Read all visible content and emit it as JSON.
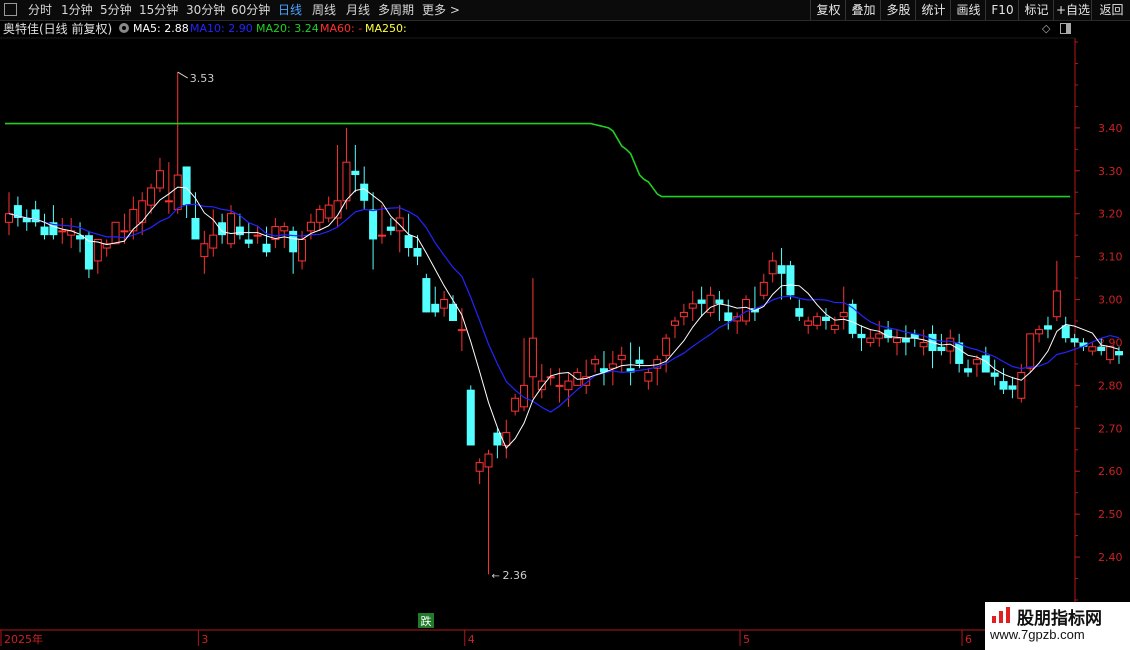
{
  "toolbar": {
    "periods": [
      "分时",
      "1分钟",
      "5分钟",
      "15分钟",
      "30分钟",
      "60分钟",
      "日线",
      "周线",
      "月线",
      "多周期",
      "更多 >"
    ],
    "active_period": "日线",
    "right_buttons": [
      "复权",
      "叠加",
      "多股",
      "统计",
      "画线",
      "F10",
      "标记",
      "+自选",
      "返回"
    ]
  },
  "info": {
    "title": "奥特佳(日线 前复权)",
    "ma5": "MA5: 2.88",
    "ma10": "MA10: 2.90",
    "ma20": "MA20: 3.24",
    "ma60": "MA60: -",
    "ma250": "MA250:"
  },
  "colors": {
    "up": "#ff3232",
    "down": "#54ffff",
    "ma5": "#ffffff",
    "ma10": "#2424ff",
    "ma20": "#20d020",
    "ma60": "#ff3030",
    "ma250": "#ffff3c",
    "axis": "#b01818",
    "label": "#cc2222"
  },
  "annotations": {
    "high": "3.53",
    "low": "2.36",
    "signal": "跌"
  },
  "watermark": {
    "name": "股朋指标网",
    "url": "www.7gpzb.com"
  },
  "chart_data": {
    "type": "candlestick",
    "ylim": [
      2.3,
      3.6
    ],
    "y_ticks": [
      3.4,
      3.3,
      3.2,
      3.1,
      3.0,
      2.9,
      2.8,
      2.7,
      2.6,
      2.5,
      2.4
    ],
    "x_labels": [
      "2025年",
      "3",
      "4",
      "5",
      "6"
    ],
    "x_label_bars": [
      0,
      22,
      52,
      83,
      108
    ],
    "ohlc": [
      [
        3.18,
        3.25,
        3.15,
        3.2
      ],
      [
        3.22,
        3.24,
        3.17,
        3.19
      ],
      [
        3.19,
        3.21,
        3.16,
        3.18
      ],
      [
        3.21,
        3.23,
        3.17,
        3.18
      ],
      [
        3.17,
        3.2,
        3.14,
        3.15
      ],
      [
        3.18,
        3.22,
        3.14,
        3.15
      ],
      [
        3.16,
        3.19,
        3.13,
        3.16
      ],
      [
        3.15,
        3.19,
        3.12,
        3.16
      ],
      [
        3.15,
        3.18,
        3.11,
        3.14
      ],
      [
        3.15,
        3.16,
        3.05,
        3.07
      ],
      [
        3.09,
        3.14,
        3.06,
        3.14
      ],
      [
        3.12,
        3.14,
        3.1,
        3.13
      ],
      [
        3.13,
        3.18,
        3.13,
        3.18
      ],
      [
        3.16,
        3.2,
        3.13,
        3.16
      ],
      [
        3.16,
        3.24,
        3.14,
        3.21
      ],
      [
        3.18,
        3.25,
        3.15,
        3.23
      ],
      [
        3.22,
        3.27,
        3.2,
        3.26
      ],
      [
        3.26,
        3.33,
        3.25,
        3.3
      ],
      [
        3.23,
        3.32,
        3.2,
        3.23
      ],
      [
        3.21,
        3.53,
        3.2,
        3.29
      ],
      [
        3.31,
        3.31,
        3.19,
        3.22
      ],
      [
        3.19,
        3.25,
        3.16,
        3.14
      ],
      [
        3.1,
        3.16,
        3.06,
        3.13
      ],
      [
        3.12,
        3.21,
        3.1,
        3.15
      ],
      [
        3.18,
        3.2,
        3.13,
        3.15
      ],
      [
        3.13,
        3.22,
        3.12,
        3.2
      ],
      [
        3.17,
        3.2,
        3.14,
        3.15
      ],
      [
        3.14,
        3.18,
        3.12,
        3.13
      ],
      [
        3.15,
        3.17,
        3.13,
        3.15
      ],
      [
        3.13,
        3.17,
        3.1,
        3.11
      ],
      [
        3.14,
        3.19,
        3.12,
        3.17
      ],
      [
        3.16,
        3.18,
        3.12,
        3.17
      ],
      [
        3.16,
        3.17,
        3.06,
        3.11
      ],
      [
        3.09,
        3.16,
        3.07,
        3.14
      ],
      [
        3.16,
        3.2,
        3.14,
        3.18
      ],
      [
        3.18,
        3.22,
        3.16,
        3.21
      ],
      [
        3.19,
        3.24,
        3.18,
        3.22
      ],
      [
        3.19,
        3.36,
        3.17,
        3.23
      ],
      [
        3.23,
        3.4,
        3.21,
        3.32
      ],
      [
        3.3,
        3.36,
        3.25,
        3.29
      ],
      [
        3.27,
        3.31,
        3.21,
        3.23
      ],
      [
        3.21,
        3.25,
        3.07,
        3.14
      ],
      [
        3.15,
        3.22,
        3.13,
        3.15
      ],
      [
        3.17,
        3.19,
        3.15,
        3.16
      ],
      [
        3.16,
        3.22,
        3.11,
        3.19
      ],
      [
        3.15,
        3.2,
        3.1,
        3.12
      ],
      [
        3.12,
        3.15,
        3.08,
        3.1
      ],
      [
        3.05,
        3.06,
        2.97,
        2.97
      ],
      [
        2.99,
        3.03,
        2.96,
        2.97
      ],
      [
        2.98,
        3.02,
        2.96,
        3.0
      ],
      [
        2.99,
        3.01,
        2.95,
        2.95
      ],
      [
        2.93,
        2.98,
        2.88,
        2.93
      ],
      [
        2.79,
        2.8,
        2.66,
        2.66
      ],
      [
        2.6,
        2.63,
        2.57,
        2.62
      ],
      [
        2.61,
        2.65,
        2.36,
        2.64
      ],
      [
        2.69,
        2.7,
        2.63,
        2.66
      ],
      [
        2.66,
        2.72,
        2.63,
        2.69
      ],
      [
        2.74,
        2.78,
        2.73,
        2.77
      ],
      [
        2.75,
        2.91,
        2.74,
        2.8
      ],
      [
        2.82,
        3.05,
        2.77,
        2.91
      ],
      [
        2.79,
        2.85,
        2.77,
        2.81
      ],
      [
        2.82,
        2.84,
        2.8,
        2.82
      ],
      [
        2.8,
        2.84,
        2.76,
        2.8
      ],
      [
        2.79,
        2.83,
        2.75,
        2.81
      ],
      [
        2.8,
        2.84,
        2.8,
        2.83
      ],
      [
        2.8,
        2.86,
        2.78,
        2.82
      ],
      [
        2.85,
        2.87,
        2.83,
        2.86
      ],
      [
        2.84,
        2.88,
        2.8,
        2.83
      ],
      [
        2.84,
        2.88,
        2.8,
        2.85
      ],
      [
        2.86,
        2.89,
        2.83,
        2.87
      ],
      [
        2.84,
        2.9,
        2.8,
        2.83
      ],
      [
        2.86,
        2.89,
        2.84,
        2.85
      ],
      [
        2.81,
        2.84,
        2.79,
        2.83
      ],
      [
        2.84,
        2.87,
        2.8,
        2.86
      ],
      [
        2.87,
        2.92,
        2.83,
        2.91
      ],
      [
        2.94,
        2.96,
        2.91,
        2.95
      ],
      [
        2.96,
        2.99,
        2.94,
        2.97
      ],
      [
        2.98,
        3.02,
        2.95,
        2.99
      ],
      [
        3.0,
        3.03,
        2.96,
        2.99
      ],
      [
        2.97,
        3.03,
        2.96,
        3.01
      ],
      [
        3.0,
        3.02,
        2.95,
        2.99
      ],
      [
        2.97,
        3.0,
        2.93,
        2.95
      ],
      [
        2.95,
        2.97,
        2.92,
        2.96
      ],
      [
        2.95,
        3.01,
        2.94,
        3.0
      ],
      [
        2.98,
        3.03,
        2.95,
        2.97
      ],
      [
        3.01,
        3.06,
        3.0,
        3.04
      ],
      [
        3.06,
        3.11,
        3.04,
        3.09
      ],
      [
        3.08,
        3.12,
        3.0,
        3.06
      ],
      [
        3.08,
        3.09,
        3.0,
        3.01
      ],
      [
        2.98,
        3.0,
        2.95,
        2.96
      ],
      [
        2.94,
        2.96,
        2.92,
        2.95
      ],
      [
        2.94,
        2.97,
        2.93,
        2.96
      ],
      [
        2.96,
        2.98,
        2.93,
        2.95
      ],
      [
        2.93,
        2.96,
        2.92,
        2.94
      ],
      [
        2.96,
        3.03,
        2.93,
        2.97
      ],
      [
        2.99,
        3.0,
        2.91,
        2.92
      ],
      [
        2.92,
        2.94,
        2.88,
        2.91
      ],
      [
        2.9,
        2.93,
        2.89,
        2.91
      ],
      [
        2.91,
        2.95,
        2.89,
        2.92
      ],
      [
        2.93,
        2.95,
        2.9,
        2.91
      ],
      [
        2.9,
        2.93,
        2.87,
        2.91
      ],
      [
        2.91,
        2.94,
        2.87,
        2.9
      ],
      [
        2.92,
        2.93,
        2.89,
        2.91
      ],
      [
        2.89,
        2.93,
        2.87,
        2.9
      ],
      [
        2.92,
        2.94,
        2.84,
        2.88
      ],
      [
        2.89,
        2.92,
        2.87,
        2.88
      ],
      [
        2.88,
        2.93,
        2.85,
        2.91
      ],
      [
        2.9,
        2.92,
        2.83,
        2.85
      ],
      [
        2.84,
        2.86,
        2.82,
        2.83
      ],
      [
        2.85,
        2.87,
        2.82,
        2.86
      ],
      [
        2.87,
        2.89,
        2.83,
        2.83
      ],
      [
        2.83,
        2.86,
        2.8,
        2.82
      ],
      [
        2.81,
        2.84,
        2.78,
        2.79
      ],
      [
        2.8,
        2.82,
        2.77,
        2.79
      ],
      [
        2.77,
        2.85,
        2.76,
        2.83
      ],
      [
        2.84,
        2.92,
        2.83,
        2.92
      ],
      [
        2.92,
        2.94,
        2.9,
        2.93
      ],
      [
        2.94,
        2.96,
        2.91,
        2.93
      ],
      [
        2.96,
        3.09,
        2.95,
        3.02
      ],
      [
        2.94,
        2.96,
        2.9,
        2.91
      ],
      [
        2.91,
        2.92,
        2.89,
        2.9
      ],
      [
        2.9,
        2.91,
        2.88,
        2.89
      ],
      [
        2.88,
        2.9,
        2.87,
        2.89
      ],
      [
        2.89,
        2.91,
        2.87,
        2.88
      ],
      [
        2.86,
        2.89,
        2.85,
        2.89
      ],
      [
        2.88,
        2.89,
        2.85,
        2.87
      ]
    ],
    "ma20_curve": [
      [
        0,
        3.41
      ],
      [
        33,
        3.41
      ],
      [
        34,
        3.4
      ],
      [
        35,
        3.35
      ],
      [
        36,
        3.28
      ],
      [
        37,
        3.24
      ],
      [
        60,
        3.24
      ]
    ]
  }
}
